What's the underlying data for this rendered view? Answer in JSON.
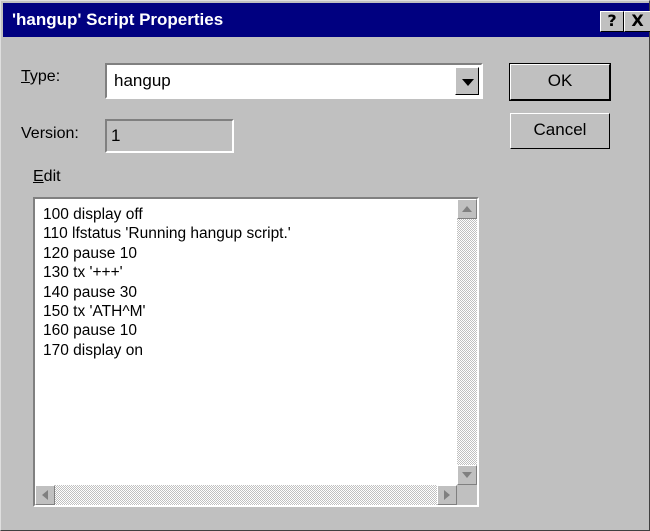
{
  "window": {
    "title": "'hangup' Script Properties",
    "help_label": "?",
    "close_label": "X"
  },
  "type_field": {
    "label_u": "T",
    "label_rest": "ype:",
    "value": "hangup"
  },
  "version_field": {
    "label": "Version:",
    "value": "1"
  },
  "buttons": {
    "ok": "OK",
    "cancel": "Cancel"
  },
  "edit": {
    "label_u": "E",
    "label_rest": "dit",
    "lines": [
      "100 display off",
      "110 lfstatus 'Running hangup script.'",
      "120 pause 10",
      "130 tx '+++'",
      "140 pause 30",
      "150 tx 'ATH^M'",
      "160 pause 10",
      "170 display on"
    ]
  }
}
